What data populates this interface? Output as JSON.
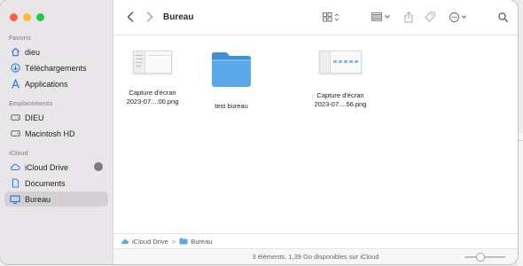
{
  "window": {
    "title": "Bureau",
    "traffic_lights": {
      "close": "#ff5f57",
      "minimize": "#febc2e",
      "zoom": "#28c840"
    }
  },
  "sidebar": {
    "sections": [
      {
        "label": "Favoris",
        "items": [
          {
            "label": "dieu",
            "icon": "home-icon"
          },
          {
            "label": "Téléchargements",
            "icon": "download-icon"
          },
          {
            "label": "Applications",
            "icon": "applications-icon"
          }
        ]
      },
      {
        "label": "Emplacements",
        "items": [
          {
            "label": "DIEU",
            "icon": "drive-icon"
          },
          {
            "label": "Macintosh HD",
            "icon": "drive-icon"
          }
        ]
      },
      {
        "label": "iCloud",
        "items": [
          {
            "label": "iCloud Drive",
            "icon": "cloud-icon"
          },
          {
            "label": "Documents",
            "icon": "document-icon"
          },
          {
            "label": "Bureau",
            "icon": "desktop-icon",
            "selected": true
          }
        ]
      }
    ]
  },
  "files": [
    {
      "line1": "Capture d'écran",
      "line2": "2023-07....00.png",
      "kind": "screenshot"
    },
    {
      "line1": "test bureau",
      "line2": "",
      "kind": "folder"
    },
    {
      "line1": "Capture d'écran",
      "line2": "2023-07....56.png",
      "kind": "screenshot"
    }
  ],
  "pathbar": {
    "crumbs": [
      "iCloud Drive",
      "Bureau"
    ],
    "separator": ">"
  },
  "statusbar": {
    "text": "3 éléments, 1,39 Go disponibles sur iCloud",
    "icon_size": 0.4
  },
  "colors": {
    "accent": "#3d8fe0",
    "folder": "#5aa7ea",
    "sidebar_bg": "#e9e6e9",
    "selection": "#d2d0d3"
  }
}
